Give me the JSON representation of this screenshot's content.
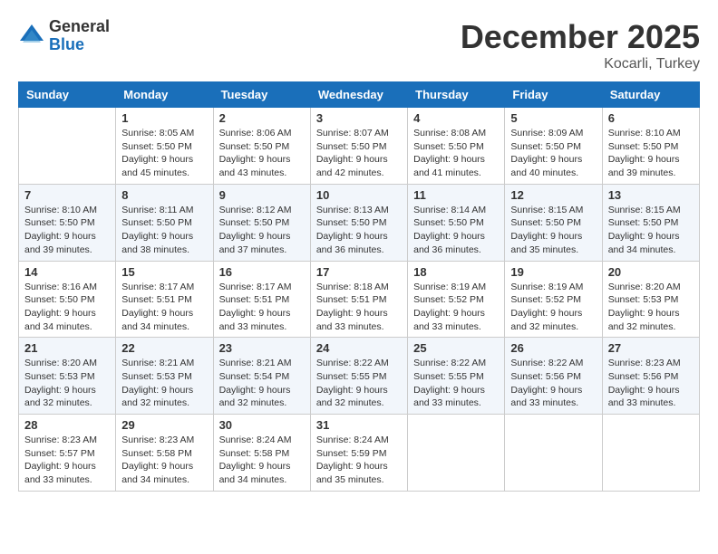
{
  "logo": {
    "general": "General",
    "blue": "Blue"
  },
  "header": {
    "month": "December 2025",
    "location": "Kocarli, Turkey"
  },
  "weekdays": [
    "Sunday",
    "Monday",
    "Tuesday",
    "Wednesday",
    "Thursday",
    "Friday",
    "Saturday"
  ],
  "weeks": [
    [
      {
        "day": "",
        "sunrise": "",
        "sunset": "",
        "daylight": ""
      },
      {
        "day": "1",
        "sunrise": "Sunrise: 8:05 AM",
        "sunset": "Sunset: 5:50 PM",
        "daylight": "Daylight: 9 hours and 45 minutes."
      },
      {
        "day": "2",
        "sunrise": "Sunrise: 8:06 AM",
        "sunset": "Sunset: 5:50 PM",
        "daylight": "Daylight: 9 hours and 43 minutes."
      },
      {
        "day": "3",
        "sunrise": "Sunrise: 8:07 AM",
        "sunset": "Sunset: 5:50 PM",
        "daylight": "Daylight: 9 hours and 42 minutes."
      },
      {
        "day": "4",
        "sunrise": "Sunrise: 8:08 AM",
        "sunset": "Sunset: 5:50 PM",
        "daylight": "Daylight: 9 hours and 41 minutes."
      },
      {
        "day": "5",
        "sunrise": "Sunrise: 8:09 AM",
        "sunset": "Sunset: 5:50 PM",
        "daylight": "Daylight: 9 hours and 40 minutes."
      },
      {
        "day": "6",
        "sunrise": "Sunrise: 8:10 AM",
        "sunset": "Sunset: 5:50 PM",
        "daylight": "Daylight: 9 hours and 39 minutes."
      }
    ],
    [
      {
        "day": "7",
        "sunrise": "Sunrise: 8:10 AM",
        "sunset": "Sunset: 5:50 PM",
        "daylight": "Daylight: 9 hours and 39 minutes."
      },
      {
        "day": "8",
        "sunrise": "Sunrise: 8:11 AM",
        "sunset": "Sunset: 5:50 PM",
        "daylight": "Daylight: 9 hours and 38 minutes."
      },
      {
        "day": "9",
        "sunrise": "Sunrise: 8:12 AM",
        "sunset": "Sunset: 5:50 PM",
        "daylight": "Daylight: 9 hours and 37 minutes."
      },
      {
        "day": "10",
        "sunrise": "Sunrise: 8:13 AM",
        "sunset": "Sunset: 5:50 PM",
        "daylight": "Daylight: 9 hours and 36 minutes."
      },
      {
        "day": "11",
        "sunrise": "Sunrise: 8:14 AM",
        "sunset": "Sunset: 5:50 PM",
        "daylight": "Daylight: 9 hours and 36 minutes."
      },
      {
        "day": "12",
        "sunrise": "Sunrise: 8:15 AM",
        "sunset": "Sunset: 5:50 PM",
        "daylight": "Daylight: 9 hours and 35 minutes."
      },
      {
        "day": "13",
        "sunrise": "Sunrise: 8:15 AM",
        "sunset": "Sunset: 5:50 PM",
        "daylight": "Daylight: 9 hours and 34 minutes."
      }
    ],
    [
      {
        "day": "14",
        "sunrise": "Sunrise: 8:16 AM",
        "sunset": "Sunset: 5:50 PM",
        "daylight": "Daylight: 9 hours and 34 minutes."
      },
      {
        "day": "15",
        "sunrise": "Sunrise: 8:17 AM",
        "sunset": "Sunset: 5:51 PM",
        "daylight": "Daylight: 9 hours and 34 minutes."
      },
      {
        "day": "16",
        "sunrise": "Sunrise: 8:17 AM",
        "sunset": "Sunset: 5:51 PM",
        "daylight": "Daylight: 9 hours and 33 minutes."
      },
      {
        "day": "17",
        "sunrise": "Sunrise: 8:18 AM",
        "sunset": "Sunset: 5:51 PM",
        "daylight": "Daylight: 9 hours and 33 minutes."
      },
      {
        "day": "18",
        "sunrise": "Sunrise: 8:19 AM",
        "sunset": "Sunset: 5:52 PM",
        "daylight": "Daylight: 9 hours and 33 minutes."
      },
      {
        "day": "19",
        "sunrise": "Sunrise: 8:19 AM",
        "sunset": "Sunset: 5:52 PM",
        "daylight": "Daylight: 9 hours and 32 minutes."
      },
      {
        "day": "20",
        "sunrise": "Sunrise: 8:20 AM",
        "sunset": "Sunset: 5:53 PM",
        "daylight": "Daylight: 9 hours and 32 minutes."
      }
    ],
    [
      {
        "day": "21",
        "sunrise": "Sunrise: 8:20 AM",
        "sunset": "Sunset: 5:53 PM",
        "daylight": "Daylight: 9 hours and 32 minutes."
      },
      {
        "day": "22",
        "sunrise": "Sunrise: 8:21 AM",
        "sunset": "Sunset: 5:53 PM",
        "daylight": "Daylight: 9 hours and 32 minutes."
      },
      {
        "day": "23",
        "sunrise": "Sunrise: 8:21 AM",
        "sunset": "Sunset: 5:54 PM",
        "daylight": "Daylight: 9 hours and 32 minutes."
      },
      {
        "day": "24",
        "sunrise": "Sunrise: 8:22 AM",
        "sunset": "Sunset: 5:55 PM",
        "daylight": "Daylight: 9 hours and 32 minutes."
      },
      {
        "day": "25",
        "sunrise": "Sunrise: 8:22 AM",
        "sunset": "Sunset: 5:55 PM",
        "daylight": "Daylight: 9 hours and 33 minutes."
      },
      {
        "day": "26",
        "sunrise": "Sunrise: 8:22 AM",
        "sunset": "Sunset: 5:56 PM",
        "daylight": "Daylight: 9 hours and 33 minutes."
      },
      {
        "day": "27",
        "sunrise": "Sunrise: 8:23 AM",
        "sunset": "Sunset: 5:56 PM",
        "daylight": "Daylight: 9 hours and 33 minutes."
      }
    ],
    [
      {
        "day": "28",
        "sunrise": "Sunrise: 8:23 AM",
        "sunset": "Sunset: 5:57 PM",
        "daylight": "Daylight: 9 hours and 33 minutes."
      },
      {
        "day": "29",
        "sunrise": "Sunrise: 8:23 AM",
        "sunset": "Sunset: 5:58 PM",
        "daylight": "Daylight: 9 hours and 34 minutes."
      },
      {
        "day": "30",
        "sunrise": "Sunrise: 8:24 AM",
        "sunset": "Sunset: 5:58 PM",
        "daylight": "Daylight: 9 hours and 34 minutes."
      },
      {
        "day": "31",
        "sunrise": "Sunrise: 8:24 AM",
        "sunset": "Sunset: 5:59 PM",
        "daylight": "Daylight: 9 hours and 35 minutes."
      },
      {
        "day": "",
        "sunrise": "",
        "sunset": "",
        "daylight": ""
      },
      {
        "day": "",
        "sunrise": "",
        "sunset": "",
        "daylight": ""
      },
      {
        "day": "",
        "sunrise": "",
        "sunset": "",
        "daylight": ""
      }
    ]
  ]
}
